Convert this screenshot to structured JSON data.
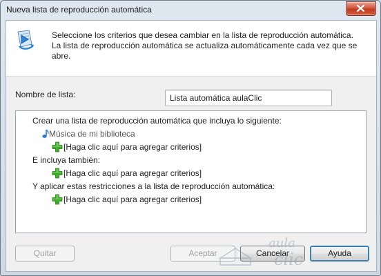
{
  "window": {
    "title": "Nueva lista de reproducción automática"
  },
  "icons": {
    "close": "close-icon",
    "playlist": "playlist-icon",
    "music_note": "music-note-icon",
    "add_criteria": "green-plus-icon",
    "watermark_logo": "aulaclic-logo"
  },
  "header": {
    "description_lines": [
      "Seleccione los criterios que desea cambiar en la lista de reproducción automática.",
      "La lista de reproducción automática se actualiza automáticamente cada vez que se",
      "abre."
    ]
  },
  "form": {
    "name_label": "Nombre de lista:",
    "name_value": "Lista automática aulaClic"
  },
  "criteria": {
    "include_heading": "Crear una lista de reproducción automática que incluya lo siguiente:",
    "library_filter": "Música de mi biblioteca",
    "add_criteria_label": "[Haga clic aquí para agregar criterios]",
    "also_include_heading": "E incluya también:",
    "restrictions_heading": "Y aplicar estas restricciones a la lista de reproducción automática:"
  },
  "buttons": {
    "remove": "Quitar",
    "accept": "Aceptar",
    "cancel": "Cancelar",
    "help": "Ayuda"
  },
  "watermark": {
    "text_top": "aula",
    "text_bottom": "clic"
  },
  "colors": {
    "accent_plus": "#3fae2a",
    "note_blue": "#2b7bd6",
    "title_bar": "#dfe7f0",
    "close_button": "#c8452a"
  }
}
